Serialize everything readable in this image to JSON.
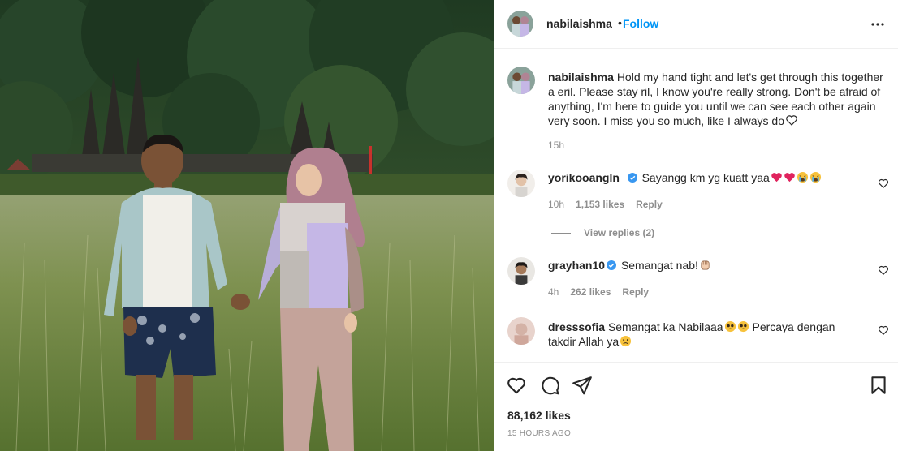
{
  "post": {
    "username": "nabilaishma",
    "follow_label": "Follow",
    "separator": "•",
    "caption": "Hold my hand tight and let's get through this together a eril. Please stay ril, I know you're really strong. Don't be afraid of anything, I'm here to guide you until we can see each other again very soon. I miss you so much, like I always do",
    "caption_time": "15h",
    "likes": "88,162 likes",
    "time_ago": "15 HOURS AGO"
  },
  "comments": [
    {
      "username": "yorikooangln_",
      "verified": true,
      "text": "Sayangg km yg kuatt yaa",
      "emojis": [
        "red-heart",
        "red-heart",
        "crying-face",
        "crying-face"
      ],
      "time": "10h",
      "likes": "1,153 likes",
      "reply_label": "Reply",
      "view_replies": "View replies (2)"
    },
    {
      "username": "grayhan10",
      "verified": true,
      "text": "Semangat nab!",
      "emojis": [
        "raised-fist"
      ],
      "time": "4h",
      "likes": "262 likes",
      "reply_label": "Reply"
    },
    {
      "username": "dresssofia",
      "verified": false,
      "text_part1": "Semangat ka Nabilaaa",
      "text_part2": "Percaya dengan takdir Allah ya",
      "emojis": [
        "pleading-face",
        "pleading-face",
        "sad-face"
      ]
    }
  ],
  "icons": {
    "more": "more-horizontal-icon",
    "like": "heart-outline-icon",
    "comment": "comment-bubble-icon",
    "share": "paper-plane-icon",
    "save": "bookmark-icon",
    "verified": "verified-badge-icon"
  },
  "colors": {
    "link_blue": "#0095f6",
    "text": "#262626",
    "muted": "#8e8e8e",
    "verified": "#3897f0",
    "heart_red": "#e0245e"
  }
}
